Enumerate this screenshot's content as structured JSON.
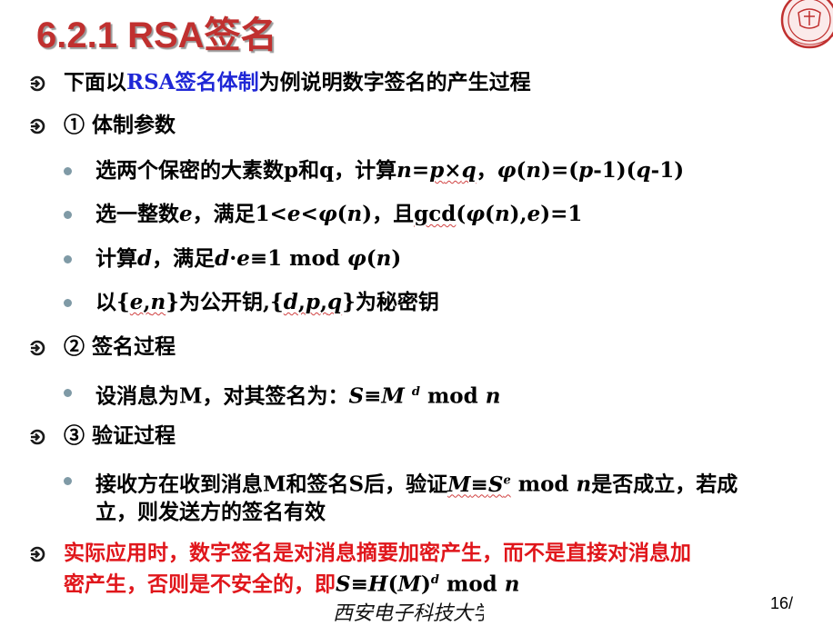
{
  "slide": {
    "title": "6.2.1  RSA签名",
    "page_number": "16/",
    "university_name": "西安电子科技大学",
    "seal_text": "XIDIAN UNIVERSITY",
    "items": [
      {
        "kind": "arrow",
        "text": "下面以RSA签名体制为例说明数字签名的产生过程"
      },
      {
        "kind": "arrow",
        "text": "① 体制参数"
      },
      {
        "kind": "dot",
        "text": "选两个保密的大素数p和q，计算n=p×q，φ(n)=(p-1)(q-1)"
      },
      {
        "kind": "dot",
        "text": "选一整数e，满足1<e<φ(n)，且gcd(φ(n),e)=1"
      },
      {
        "kind": "dot",
        "text": "计算d，满足d·e≡1 mod φ(n)"
      },
      {
        "kind": "dot",
        "text": "以{e,n}为公开钥,{d,p,q}为秘密钥"
      },
      {
        "kind": "arrow",
        "text": "② 签名过程"
      },
      {
        "kind": "dot",
        "text": "设消息为M，对其签名为：S≡M d mod n"
      },
      {
        "kind": "arrow",
        "text": "③ 验证过程"
      },
      {
        "kind": "dot",
        "text": "接收方在收到消息M和签名S后，验证M≡Se mod n是否成立，若成立，则发送方的签名有效"
      },
      {
        "kind": "arrow",
        "text": "实际应用时，数字签名是对消息摘要加密产生，而不是直接对消息加密产生，否则是不安全的，即S≡H(M)d mod n"
      }
    ],
    "colors": {
      "title": "#c0302f",
      "highlight_blue": "#1f27d6",
      "highlight_red": "#e0161b",
      "bullet_dot": "#7f9aa6"
    }
  }
}
